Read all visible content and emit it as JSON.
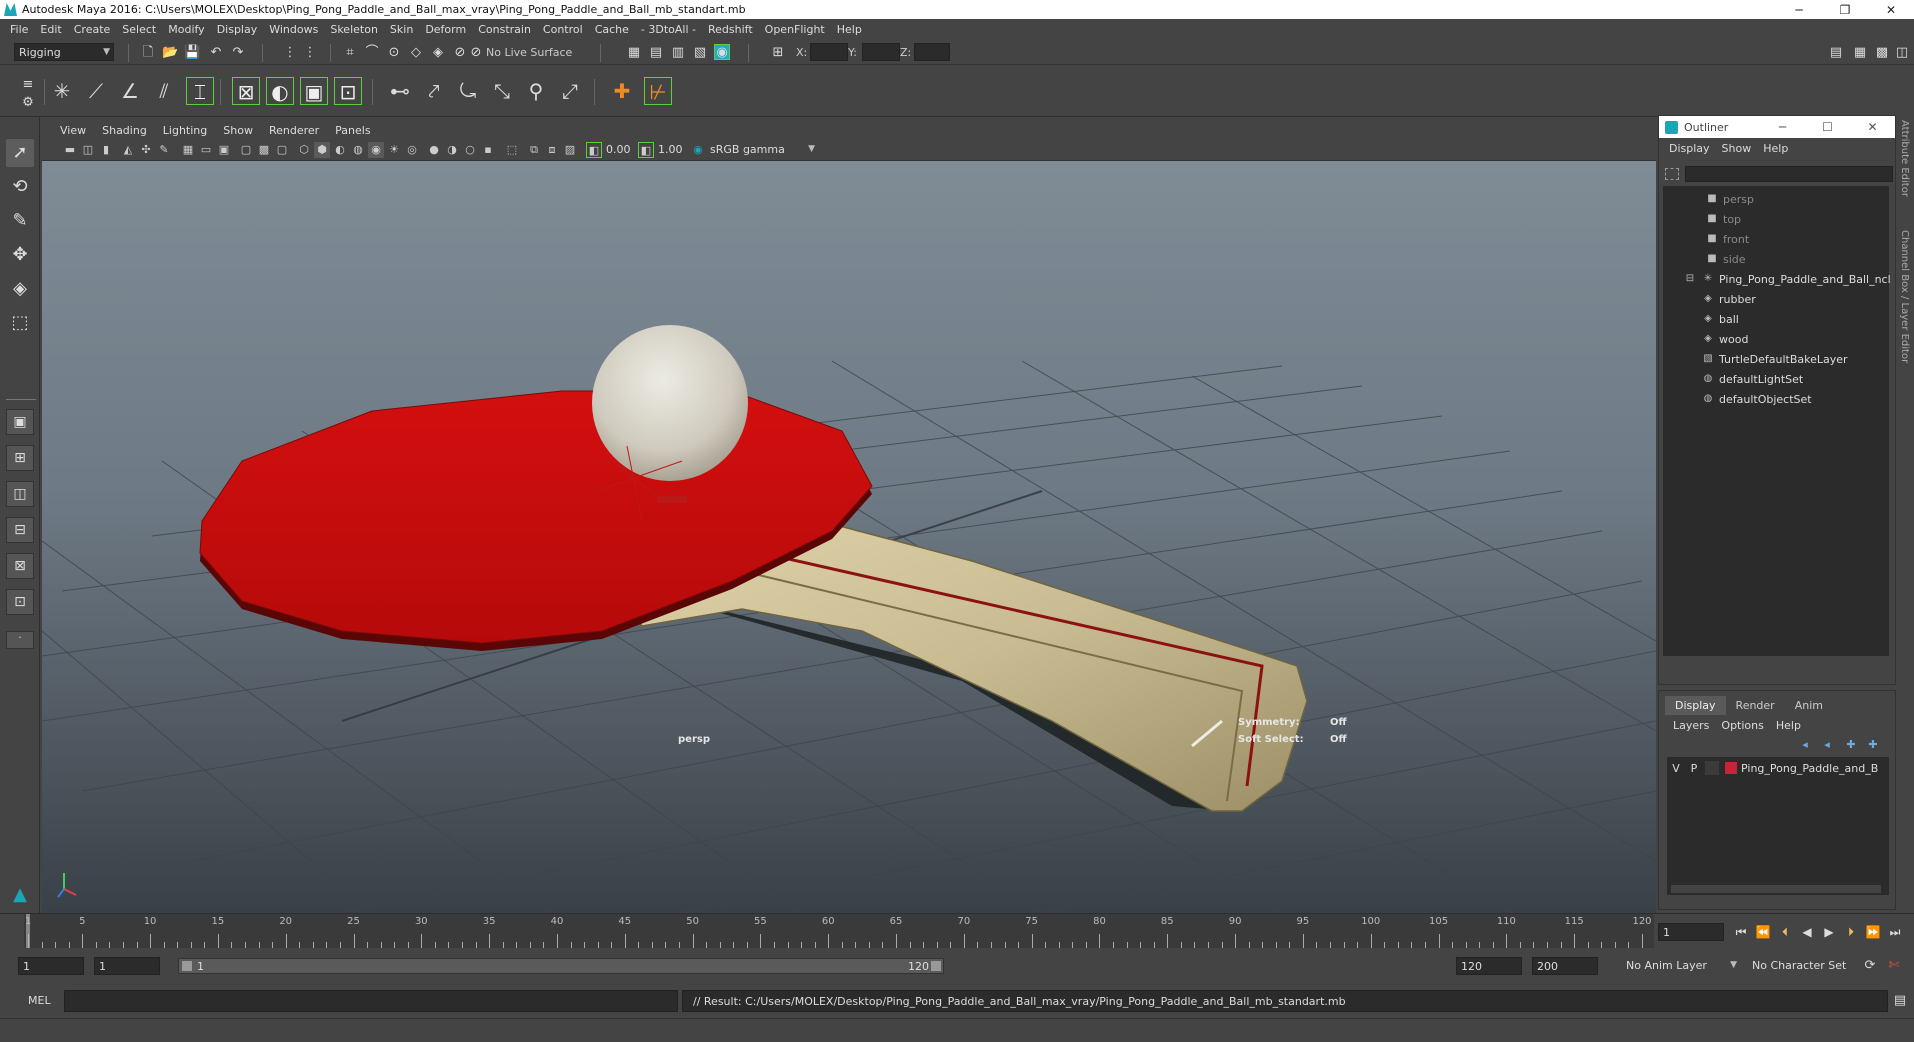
{
  "window": {
    "title": "Autodesk Maya 2016: C:\\Users\\MOLEX\\Desktop\\Ping_Pong_Paddle_and_Ball_max_vray\\Ping_Pong_Paddle_and_Ball_mb_standart.mb",
    "minimize": "─",
    "restore": "❐",
    "close": "✕"
  },
  "menubar": [
    "File",
    "Edit",
    "Create",
    "Select",
    "Modify",
    "Display",
    "Windows",
    "Skeleton",
    "Skin",
    "Deform",
    "Constrain",
    "Control",
    "Cache",
    "- 3DtoAll -",
    "Redshift",
    "OpenFlight",
    "Help"
  ],
  "statusline": {
    "menuset": "Rigging",
    "live_surface": "No Live Surface",
    "x_label": "X:",
    "y_label": "Y:",
    "z_label": "Z:"
  },
  "viewport": {
    "menus": [
      "View",
      "Shading",
      "Lighting",
      "Show",
      "Renderer",
      "Panels"
    ],
    "exposure": "0.00",
    "gamma": "1.00",
    "color_space": "sRGB gamma",
    "camera_label": "persp",
    "symmetry_label": "Symmetry:",
    "symmetry_value": "Off",
    "soft_select_label": "Soft Select:",
    "soft_select_value": "Off"
  },
  "outliner": {
    "title": "Outliner",
    "menus": [
      "Display",
      "Show",
      "Help"
    ],
    "items": [
      {
        "label": "persp",
        "icon": "camera-icon",
        "dim": true
      },
      {
        "label": "top",
        "icon": "camera-icon",
        "dim": true
      },
      {
        "label": "front",
        "icon": "camera-icon",
        "dim": true
      },
      {
        "label": "side",
        "icon": "camera-icon",
        "dim": true
      },
      {
        "label": "Ping_Pong_Paddle_and_Ball_ncl",
        "icon": "group-icon",
        "dim": false
      },
      {
        "label": "rubber",
        "icon": "mesh-icon",
        "dim": false
      },
      {
        "label": "ball",
        "icon": "mesh-icon",
        "dim": false
      },
      {
        "label": "wood",
        "icon": "mesh-icon",
        "dim": false
      },
      {
        "label": "TurtleDefaultBakeLayer",
        "icon": "bake-layer-icon",
        "dim": false
      },
      {
        "label": "defaultLightSet",
        "icon": "set-icon",
        "dim": false
      },
      {
        "label": "defaultObjectSet",
        "icon": "set-icon",
        "dim": false
      }
    ]
  },
  "layer_editor": {
    "tabs": [
      "Display",
      "Render",
      "Anim"
    ],
    "menus": [
      "Layers",
      "Options",
      "Help"
    ],
    "layer": {
      "v": "V",
      "p": "P",
      "name": "Ping_Pong_Paddle_and_B",
      "color": "#c8233a"
    }
  },
  "side_tabs": [
    "Attribute Editor",
    "Channel Box / Layer Editor"
  ],
  "timeslider": {
    "ticks": [
      1,
      5,
      10,
      15,
      20,
      25,
      30,
      35,
      40,
      45,
      50,
      55,
      60,
      65,
      70,
      75,
      80,
      85,
      90,
      95,
      100,
      105,
      110,
      115,
      120
    ],
    "current_frame": "1"
  },
  "rangeslider": {
    "start_time": "1",
    "playback_start": "1",
    "range_start": "1",
    "range_end": "120",
    "playback_end": "120",
    "end_time": "200",
    "anim_layer": "No Anim Layer",
    "character_set": "No Character Set"
  },
  "cmdline": {
    "language": "MEL",
    "result": "// Result: C:/Users/MOLEX/Desktop/Ping_Pong_Paddle_and_Ball_max_vray/Ping_Pong_Paddle_and_Ball_mb_standart.mb"
  },
  "colors": {
    "rubber": "#c40d0d",
    "wood": "#c9bc93",
    "ball": "#d8d4c8",
    "accent": "#1aa6b6"
  }
}
